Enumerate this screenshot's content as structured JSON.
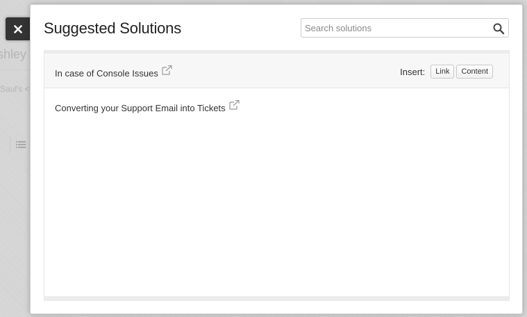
{
  "background": {
    "name_fragment": "shley",
    "from_fragment": "Saul's <",
    "list_icon": "list-icon"
  },
  "close": {
    "icon": "close-icon",
    "glyph": "✕"
  },
  "modal": {
    "title": "Suggested Solutions",
    "search": {
      "placeholder": "Search solutions",
      "value": "",
      "icon": "search-icon"
    },
    "results": [
      {
        "title": "In case of Console Issues",
        "icon": "external-link-icon",
        "insert": {
          "label": "Insert:",
          "link_label": "Link",
          "content_label": "Content"
        }
      },
      {
        "title": "Converting your Support Email into Tickets",
        "icon": "external-link-icon"
      }
    ]
  },
  "colors": {
    "overlay": "#d9d9d9",
    "close_bg": "#333333",
    "modal_bg": "#ffffff",
    "highlight_row": "#f7f7f7",
    "text": "#333333"
  }
}
